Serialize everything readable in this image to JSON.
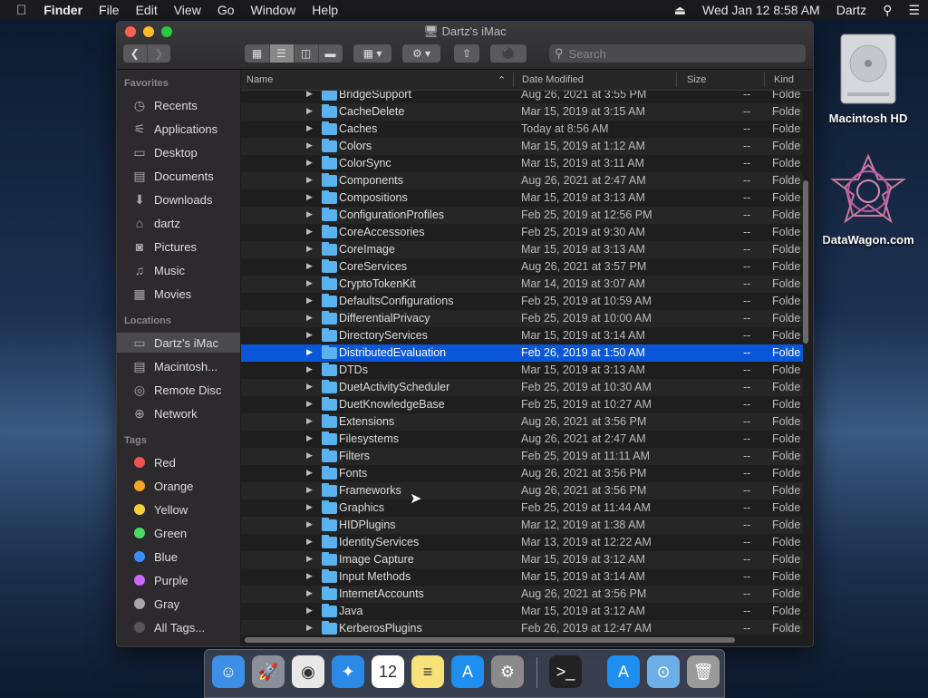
{
  "menubar": {
    "app": "Finder",
    "items": [
      "File",
      "Edit",
      "View",
      "Go",
      "Window",
      "Help"
    ],
    "clock": "Wed Jan 12  8:58 AM",
    "user": "Dartz"
  },
  "desktop": {
    "icons": [
      {
        "label": "Macintosh HD"
      },
      {
        "label": "DataWagon.com"
      }
    ]
  },
  "window": {
    "title": "Dartz's iMac",
    "search_placeholder": "Search",
    "columns": {
      "name": "Name",
      "date": "Date Modified",
      "size": "Size",
      "kind": "Kind"
    }
  },
  "sidebar": {
    "favorites_header": "Favorites",
    "favorites": [
      {
        "label": "Recents",
        "icon": "clock-icon"
      },
      {
        "label": "Applications",
        "icon": "applications-icon"
      },
      {
        "label": "Desktop",
        "icon": "desktop-icon"
      },
      {
        "label": "Documents",
        "icon": "document-icon"
      },
      {
        "label": "Downloads",
        "icon": "download-icon"
      },
      {
        "label": "dartz",
        "icon": "home-icon"
      },
      {
        "label": "Pictures",
        "icon": "camera-icon"
      },
      {
        "label": "Music",
        "icon": "music-icon"
      },
      {
        "label": "Movies",
        "icon": "film-icon"
      }
    ],
    "locations_header": "Locations",
    "locations": [
      {
        "label": "Dartz's iMac",
        "icon": "computer-icon"
      },
      {
        "label": "Macintosh...",
        "icon": "disk-icon"
      },
      {
        "label": "Remote Disc",
        "icon": "disc-icon"
      },
      {
        "label": "Network",
        "icon": "globe-icon"
      }
    ],
    "tags_header": "Tags",
    "tags": [
      {
        "label": "Red",
        "color": "#ef5350"
      },
      {
        "label": "Orange",
        "color": "#f5a623"
      },
      {
        "label": "Yellow",
        "color": "#f2d13b"
      },
      {
        "label": "Green",
        "color": "#4cd964"
      },
      {
        "label": "Blue",
        "color": "#3a8dff"
      },
      {
        "label": "Purple",
        "color": "#c86bfa"
      },
      {
        "label": "Gray",
        "color": "#a8a8a8"
      },
      {
        "label": "All Tags...",
        "color": "#555555"
      }
    ]
  },
  "files": [
    {
      "name": "BridgeSupport",
      "date": "Aug 26, 2021 at 3:55 PM",
      "size": "--",
      "kind": "Folde"
    },
    {
      "name": "CacheDelete",
      "date": "Mar 15, 2019 at 3:15 AM",
      "size": "--",
      "kind": "Folde"
    },
    {
      "name": "Caches",
      "date": "Today at 8:56 AM",
      "size": "--",
      "kind": "Folde"
    },
    {
      "name": "Colors",
      "date": "Mar 15, 2019 at 1:12 AM",
      "size": "--",
      "kind": "Folde"
    },
    {
      "name": "ColorSync",
      "date": "Mar 15, 2019 at 3:11 AM",
      "size": "--",
      "kind": "Folde"
    },
    {
      "name": "Components",
      "date": "Aug 26, 2021 at 2:47 AM",
      "size": "--",
      "kind": "Folde"
    },
    {
      "name": "Compositions",
      "date": "Mar 15, 2019 at 3:13 AM",
      "size": "--",
      "kind": "Folde"
    },
    {
      "name": "ConfigurationProfiles",
      "date": "Feb 25, 2019 at 12:56 PM",
      "size": "--",
      "kind": "Folde"
    },
    {
      "name": "CoreAccessories",
      "date": "Feb 25, 2019 at 9:30 AM",
      "size": "--",
      "kind": "Folde"
    },
    {
      "name": "CoreImage",
      "date": "Mar 15, 2019 at 3:13 AM",
      "size": "--",
      "kind": "Folde"
    },
    {
      "name": "CoreServices",
      "date": "Aug 26, 2021 at 3:57 PM",
      "size": "--",
      "kind": "Folde"
    },
    {
      "name": "CryptoTokenKit",
      "date": "Mar 14, 2019 at 3:07 AM",
      "size": "--",
      "kind": "Folde"
    },
    {
      "name": "DefaultsConfigurations",
      "date": "Feb 25, 2019 at 10:59 AM",
      "size": "--",
      "kind": "Folde"
    },
    {
      "name": "DifferentialPrivacy",
      "date": "Feb 25, 2019 at 10:00 AM",
      "size": "--",
      "kind": "Folde"
    },
    {
      "name": "DirectoryServices",
      "date": "Mar 15, 2019 at 3:14 AM",
      "size": "--",
      "kind": "Folde"
    },
    {
      "name": "DistributedEvaluation",
      "date": "Feb 26, 2019 at 1:50 AM",
      "size": "--",
      "kind": "Folde",
      "selected": true
    },
    {
      "name": "DTDs",
      "date": "Mar 15, 2019 at 3:13 AM",
      "size": "--",
      "kind": "Folde"
    },
    {
      "name": "DuetActivityScheduler",
      "date": "Feb 25, 2019 at 10:30 AM",
      "size": "--",
      "kind": "Folde"
    },
    {
      "name": "DuetKnowledgeBase",
      "date": "Feb 25, 2019 at 10:27 AM",
      "size": "--",
      "kind": "Folde"
    },
    {
      "name": "Extensions",
      "date": "Aug 26, 2021 at 3:56 PM",
      "size": "--",
      "kind": "Folde"
    },
    {
      "name": "Filesystems",
      "date": "Aug 26, 2021 at 2:47 AM",
      "size": "--",
      "kind": "Folde"
    },
    {
      "name": "Filters",
      "date": "Feb 25, 2019 at 11:11 AM",
      "size": "--",
      "kind": "Folde"
    },
    {
      "name": "Fonts",
      "date": "Aug 26, 2021 at 3:56 PM",
      "size": "--",
      "kind": "Folde"
    },
    {
      "name": "Frameworks",
      "date": "Aug 26, 2021 at 3:56 PM",
      "size": "--",
      "kind": "Folde"
    },
    {
      "name": "Graphics",
      "date": "Feb 25, 2019 at 11:44 AM",
      "size": "--",
      "kind": "Folde"
    },
    {
      "name": "HIDPlugins",
      "date": "Mar 12, 2019 at 1:38 AM",
      "size": "--",
      "kind": "Folde"
    },
    {
      "name": "IdentityServices",
      "date": "Mar 13, 2019 at 12:22 AM",
      "size": "--",
      "kind": "Folde"
    },
    {
      "name": "Image Capture",
      "date": "Mar 15, 2019 at 3:12 AM",
      "size": "--",
      "kind": "Folde"
    },
    {
      "name": "Input Methods",
      "date": "Mar 15, 2019 at 3:14 AM",
      "size": "--",
      "kind": "Folde"
    },
    {
      "name": "InternetAccounts",
      "date": "Aug 26, 2021 at 3:56 PM",
      "size": "--",
      "kind": "Folde"
    },
    {
      "name": "Java",
      "date": "Mar 15, 2019 at 3:12 AM",
      "size": "--",
      "kind": "Folde"
    },
    {
      "name": "KerberosPlugins",
      "date": "Feb 26, 2019 at 12:47 AM",
      "size": "--",
      "kind": "Folde"
    }
  ],
  "dock": {
    "items": [
      {
        "name": "finder-icon",
        "color": "#3d8fe6",
        "glyph": "☺"
      },
      {
        "name": "launchpad-icon",
        "color": "#8a8f9a",
        "glyph": "🚀"
      },
      {
        "name": "chrome-icon",
        "color": "#e8e8e8",
        "glyph": "◉"
      },
      {
        "name": "safari-icon",
        "color": "#2b8ae6",
        "glyph": "✦"
      },
      {
        "name": "calendar-icon",
        "color": "#ffffff",
        "glyph": "12"
      },
      {
        "name": "notes-icon",
        "color": "#f7e27a",
        "glyph": "≡"
      },
      {
        "name": "app-store-icon",
        "color": "#1e8ef0",
        "glyph": "A"
      },
      {
        "name": "system-preferences-icon",
        "color": "#8a8a8a",
        "glyph": "⚙"
      },
      {
        "name": "terminal-icon",
        "color": "#222222",
        "glyph": ">_"
      },
      {
        "name": "app-store-folder-icon",
        "color": "#1e8ef0",
        "glyph": "A"
      },
      {
        "name": "downloads-folder-icon",
        "color": "#6eaee8",
        "glyph": "⊙"
      },
      {
        "name": "trash-icon",
        "color": "#9a9a9a",
        "glyph": "🗑"
      }
    ]
  }
}
